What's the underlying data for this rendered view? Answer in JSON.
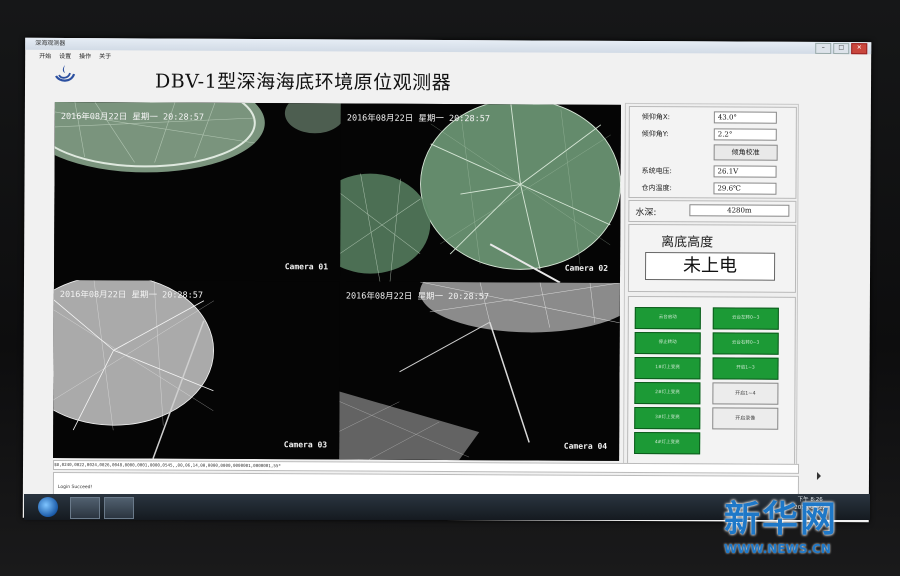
{
  "window": {
    "titlebar_text": "深海观测器",
    "controls": {
      "minimize": "–",
      "maximize": "□",
      "close": "✕"
    }
  },
  "menu": [
    "开始",
    "设置",
    "操作",
    "关于"
  ],
  "app_title": "DBV-1型深海海底环境原位观测器",
  "cameras": [
    {
      "timestamp": "2016年08月22日 星期一 20:28:57",
      "label": "Camera 01"
    },
    {
      "timestamp": "2016年08月22日 星期一 20:28:57",
      "label": "Camera 02"
    },
    {
      "timestamp": "2016年08月22日 星期一 20:28:57",
      "label": "Camera 03"
    },
    {
      "timestamp": "2016年08月22日 星期一 20:28:57",
      "label": "Camera 04"
    }
  ],
  "sensors": {
    "tilt_x_label": "倾仰角X:",
    "tilt_x_value": "43.0°",
    "tilt_y_label": "倾仰角Y:",
    "tilt_y_value": "2.2°",
    "calibrate_label": "倾角校准",
    "voltage_label": "系统电压:",
    "voltage_value": "26.1V",
    "temp_label": "仓内温度:",
    "temp_value": "29.6℃",
    "depth_label": "水深:",
    "depth_value": "4280m"
  },
  "altitude": {
    "label": "离底高度",
    "value": "未上电"
  },
  "control_buttons": {
    "left": [
      "云台启动",
      "停止转动",
      "1#灯上变亮",
      "2#灯上变亮",
      "3#灯上变亮",
      "4#灯上变亮"
    ],
    "right": [
      "云台左转0~3",
      "云台右转0~3",
      "开启1~3",
      "开启1~4",
      "开启录像"
    ]
  },
  "status": {
    "data_line": "$B,0240,0022,0024,0026,0048,0000,0001,0000,0545,,00,06,14,00,0000,0000,0000001,0000001,55*",
    "log_text": "Login Succeed!"
  },
  "taskbar": {
    "clock_time": "下午 8:26",
    "clock_date": "2016/08/22"
  },
  "watermark": {
    "main": "新华网",
    "sub": "WWW.NEWS.CN"
  }
}
